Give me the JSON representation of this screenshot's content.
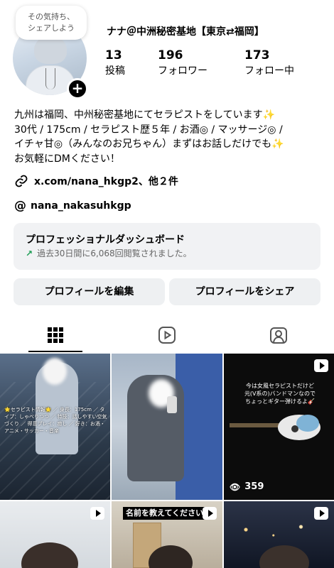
{
  "profile": {
    "note_line1": "その気持ち、",
    "note_line2": "シェアしよう",
    "display_name": "ナナ＠中洲秘密基地【東京⇄福岡】",
    "stats": {
      "posts_count": "13",
      "posts_label": "投稿",
      "followers_count": "196",
      "followers_label": "フォロワー",
      "following_count": "173",
      "following_label": "フォロー中"
    },
    "bio_line1": "九州は福岡、中州秘密基地にてセラピストをしています✨",
    "bio_line2": "30代 / 175cm / セラピスト歴５年 / お酒◎ / マッサージ◎ /",
    "bio_line3": "イチャ甘◎（みんなのお兄ちゃん）まずはお話しだけでも✨",
    "bio_line4": "お気軽にDMください！",
    "link_text": "x.com/nana_hkgp2、他２件",
    "threads_handle": "nana_nakasuhkgp"
  },
  "dashboard": {
    "title": "プロフェッショナルダッシュボード",
    "subtitle": "過去30日間に6,068回閲覧されました。",
    "trend_color": "#1a9c52"
  },
  "buttons": {
    "edit_profile": "プロフィールを編集",
    "share_profile": "プロフィールをシェア"
  },
  "tabs": {
    "icons": [
      "grid-icon",
      "reels-icon",
      "tagged-icon"
    ],
    "active": "grid"
  },
  "posts": {
    "post1_caption": "🌟セラピスト情報🌟 ／ 身長：175cm ／ タイプ：しゃべりつつ ／ 特技：話しやすい空気づくり ／ 得意プレイ：癒し ／ 好き：お酒・アニメ・サッカー・音楽",
    "post3_text_line1": "今は女風セラピストだけど",
    "post3_text_line2": "元(V系の)バンドマンなので",
    "post3_text_line3": "ちょっとギター弾けるよ🎸",
    "post3_views": "359",
    "post5_banner": "名前を教えてください"
  }
}
